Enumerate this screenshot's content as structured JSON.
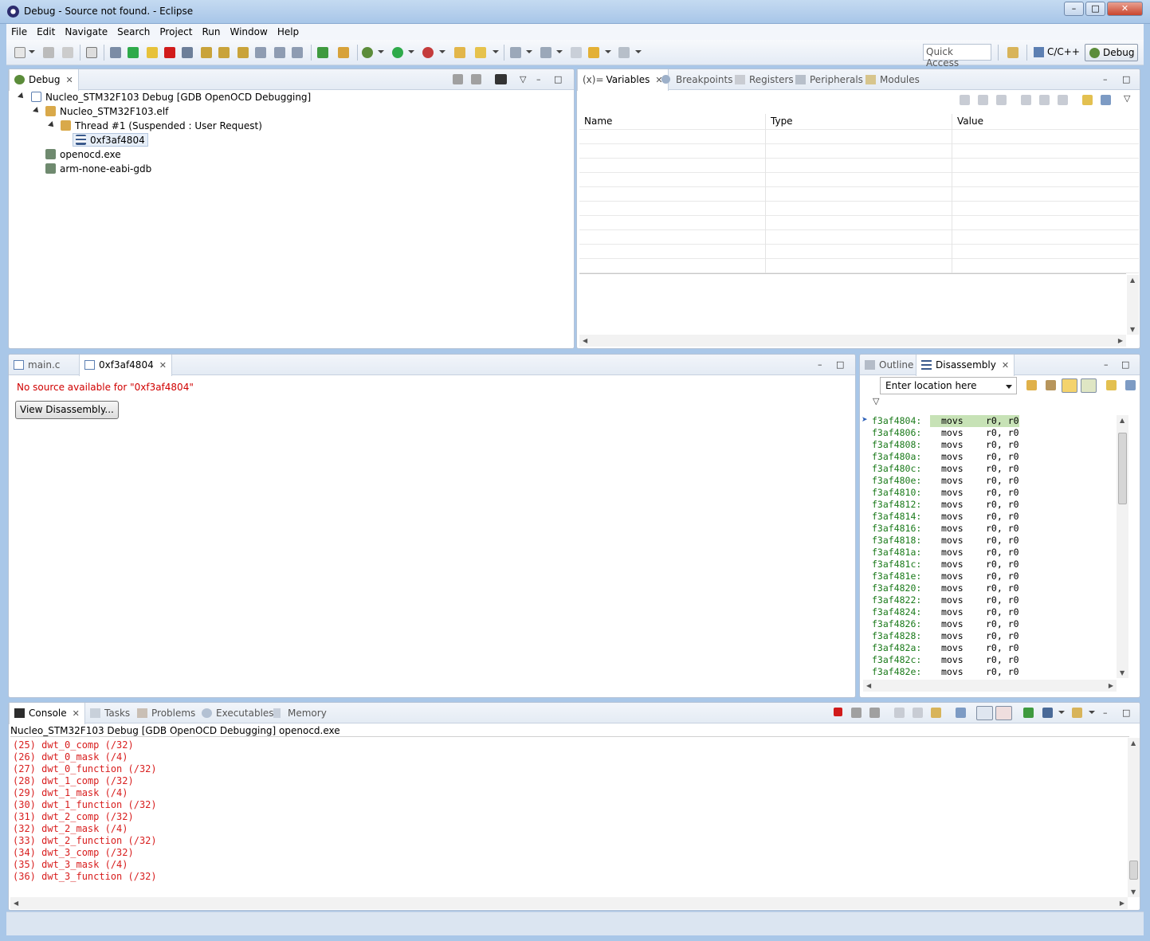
{
  "window": {
    "title": "Debug - Source not found. - Eclipse"
  },
  "menu": [
    "File",
    "Edit",
    "Navigate",
    "Search",
    "Project",
    "Run",
    "Window",
    "Help"
  ],
  "toolbar": {
    "quick_access_placeholder": "Quick Access",
    "perspectives": [
      {
        "label": "C/C++",
        "active": false
      },
      {
        "label": "Debug",
        "active": true
      }
    ]
  },
  "debug_view": {
    "tab": "Debug",
    "tree": [
      {
        "label": "Nucleo_STM32F103 Debug [GDB OpenOCD Debugging]",
        "level": 0,
        "icon": "launch-config-icon"
      },
      {
        "label": "Nucleo_STM32F103.elf",
        "level": 1,
        "icon": "debug-target-icon"
      },
      {
        "label": "Thread #1 (Suspended : User Request)",
        "level": 2,
        "icon": "thread-suspended-icon"
      },
      {
        "label": "0xf3af4804",
        "level": 3,
        "icon": "stack-frame-icon",
        "selected": true
      },
      {
        "label": "openocd.exe",
        "level": 1,
        "icon": "process-icon"
      },
      {
        "label": "arm-none-eabi-gdb",
        "level": 1,
        "icon": "process-icon"
      }
    ]
  },
  "variables_view": {
    "tabs": [
      "Variables",
      "Breakpoints",
      "Registers",
      "Peripherals",
      "Modules"
    ],
    "tab_prefix": "(x)=",
    "columns": [
      "Name",
      "Type",
      "Value"
    ]
  },
  "editor": {
    "tabs": [
      {
        "label": "main.c",
        "active": false
      },
      {
        "label": "0xf3af4804",
        "active": true
      }
    ],
    "message": "No source available for \"0xf3af4804\"",
    "button": "View Disassembly..."
  },
  "disassembly_view": {
    "tabs": [
      "Outline",
      "Disassembly"
    ],
    "location_placeholder": "Enter location here",
    "lines": [
      {
        "addr": "f3af4804:",
        "mnemonic": "movs",
        "operands": "r0, r0",
        "current": true
      },
      {
        "addr": "f3af4806:",
        "mnemonic": "movs",
        "operands": "r0, r0"
      },
      {
        "addr": "f3af4808:",
        "mnemonic": "movs",
        "operands": "r0, r0"
      },
      {
        "addr": "f3af480a:",
        "mnemonic": "movs",
        "operands": "r0, r0"
      },
      {
        "addr": "f3af480c:",
        "mnemonic": "movs",
        "operands": "r0, r0"
      },
      {
        "addr": "f3af480e:",
        "mnemonic": "movs",
        "operands": "r0, r0"
      },
      {
        "addr": "f3af4810:",
        "mnemonic": "movs",
        "operands": "r0, r0"
      },
      {
        "addr": "f3af4812:",
        "mnemonic": "movs",
        "operands": "r0, r0"
      },
      {
        "addr": "f3af4814:",
        "mnemonic": "movs",
        "operands": "r0, r0"
      },
      {
        "addr": "f3af4816:",
        "mnemonic": "movs",
        "operands": "r0, r0"
      },
      {
        "addr": "f3af4818:",
        "mnemonic": "movs",
        "operands": "r0, r0"
      },
      {
        "addr": "f3af481a:",
        "mnemonic": "movs",
        "operands": "r0, r0"
      },
      {
        "addr": "f3af481c:",
        "mnemonic": "movs",
        "operands": "r0, r0"
      },
      {
        "addr": "f3af481e:",
        "mnemonic": "movs",
        "operands": "r0, r0"
      },
      {
        "addr": "f3af4820:",
        "mnemonic": "movs",
        "operands": "r0, r0"
      },
      {
        "addr": "f3af4822:",
        "mnemonic": "movs",
        "operands": "r0, r0"
      },
      {
        "addr": "f3af4824:",
        "mnemonic": "movs",
        "operands": "r0, r0"
      },
      {
        "addr": "f3af4826:",
        "mnemonic": "movs",
        "operands": "r0, r0"
      },
      {
        "addr": "f3af4828:",
        "mnemonic": "movs",
        "operands": "r0, r0"
      },
      {
        "addr": "f3af482a:",
        "mnemonic": "movs",
        "operands": "r0, r0"
      },
      {
        "addr": "f3af482c:",
        "mnemonic": "movs",
        "operands": "r0, r0"
      },
      {
        "addr": "f3af482e:",
        "mnemonic": "movs",
        "operands": "r0, r0"
      }
    ]
  },
  "console_view": {
    "tabs": [
      "Console",
      "Tasks",
      "Problems",
      "Executables",
      "Memory"
    ],
    "header": "Nucleo_STM32F103 Debug [GDB OpenOCD Debugging] openocd.exe",
    "lines": [
      "(25) dwt_0_comp (/32)",
      "(26) dwt_0_mask (/4)",
      "(27) dwt_0_function (/32)",
      "(28) dwt_1_comp (/32)",
      "(29) dwt_1_mask (/4)",
      "(30) dwt_1_function (/32)",
      "(31) dwt_2_comp (/32)",
      "(32) dwt_2_mask (/4)",
      "(33) dwt_2_function (/32)",
      "(34) dwt_3_comp (/32)",
      "(35) dwt_3_mask (/4)",
      "(36) dwt_3_function (/32)"
    ]
  },
  "colors": {
    "console_text": "#d81e1e",
    "error_text": "#d00000",
    "address_text": "#1a7a1a",
    "current_line_highlight": "#c7e2b6",
    "window_frame": "#a9c7e8"
  }
}
